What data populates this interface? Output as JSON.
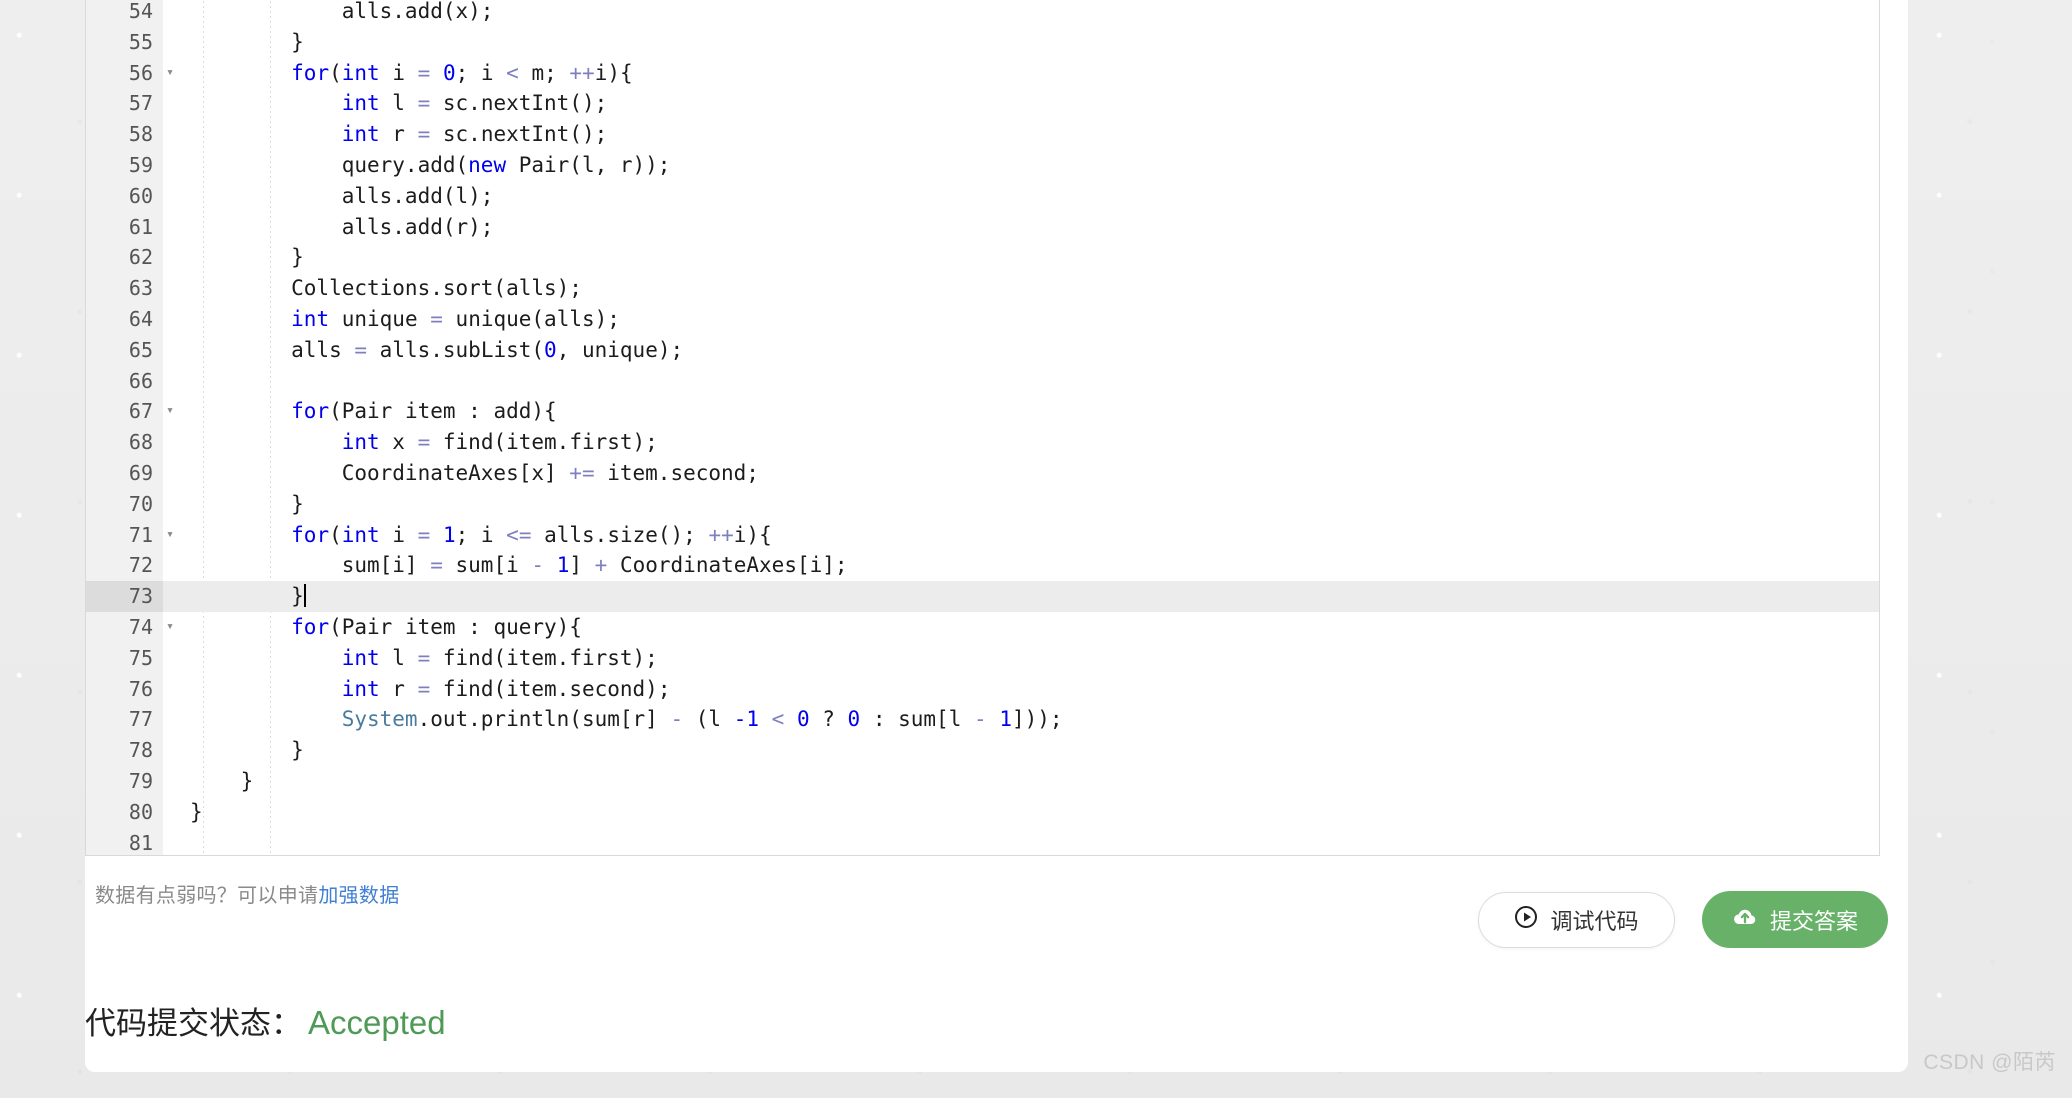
{
  "editor": {
    "language": "java",
    "active_line": 73,
    "first_visible_line": 54,
    "lines": [
      {
        "n": "54",
        "fold": false,
        "indent": 2,
        "tokens": [
          {
            "t": "            alls.add(x);",
            "c": "plain"
          }
        ]
      },
      {
        "n": "55",
        "fold": false,
        "indent": 2,
        "tokens": [
          {
            "t": "        }",
            "c": "plain"
          }
        ]
      },
      {
        "n": "56",
        "fold": true,
        "indent": 2,
        "tokens": [
          {
            "t": "        ",
            "c": "plain"
          },
          {
            "t": "for",
            "c": "kw"
          },
          {
            "t": "(",
            "c": "plain"
          },
          {
            "t": "int",
            "c": "kw"
          },
          {
            "t": " i ",
            "c": "plain"
          },
          {
            "t": "=",
            "c": "op"
          },
          {
            "t": " ",
            "c": "plain"
          },
          {
            "t": "0",
            "c": "num"
          },
          {
            "t": "; i ",
            "c": "plain"
          },
          {
            "t": "<",
            "c": "op"
          },
          {
            "t": " m; ",
            "c": "plain"
          },
          {
            "t": "++",
            "c": "op"
          },
          {
            "t": "i){",
            "c": "plain"
          }
        ]
      },
      {
        "n": "57",
        "fold": false,
        "indent": 3,
        "tokens": [
          {
            "t": "            ",
            "c": "plain"
          },
          {
            "t": "int",
            "c": "kw"
          },
          {
            "t": " l ",
            "c": "plain"
          },
          {
            "t": "=",
            "c": "op"
          },
          {
            "t": " sc.nextInt();",
            "c": "plain"
          }
        ]
      },
      {
        "n": "58",
        "fold": false,
        "indent": 3,
        "tokens": [
          {
            "t": "            ",
            "c": "plain"
          },
          {
            "t": "int",
            "c": "kw"
          },
          {
            "t": " r ",
            "c": "plain"
          },
          {
            "t": "=",
            "c": "op"
          },
          {
            "t": " sc.nextInt();",
            "c": "plain"
          }
        ]
      },
      {
        "n": "59",
        "fold": false,
        "indent": 3,
        "tokens": [
          {
            "t": "            query.add(",
            "c": "plain"
          },
          {
            "t": "new",
            "c": "kw"
          },
          {
            "t": " Pair(l, r));",
            "c": "plain"
          }
        ]
      },
      {
        "n": "60",
        "fold": false,
        "indent": 3,
        "tokens": [
          {
            "t": "            alls.add(l);",
            "c": "plain"
          }
        ]
      },
      {
        "n": "61",
        "fold": false,
        "indent": 3,
        "tokens": [
          {
            "t": "            alls.add(r);",
            "c": "plain"
          }
        ]
      },
      {
        "n": "62",
        "fold": false,
        "indent": 2,
        "tokens": [
          {
            "t": "        }",
            "c": "plain"
          }
        ]
      },
      {
        "n": "63",
        "fold": false,
        "indent": 2,
        "tokens": [
          {
            "t": "        Collections.sort(alls);",
            "c": "plain"
          }
        ]
      },
      {
        "n": "64",
        "fold": false,
        "indent": 2,
        "tokens": [
          {
            "t": "        ",
            "c": "plain"
          },
          {
            "t": "int",
            "c": "kw"
          },
          {
            "t": " unique ",
            "c": "plain"
          },
          {
            "t": "=",
            "c": "op"
          },
          {
            "t": " unique(alls);",
            "c": "plain"
          }
        ]
      },
      {
        "n": "65",
        "fold": false,
        "indent": 2,
        "tokens": [
          {
            "t": "        alls ",
            "c": "plain"
          },
          {
            "t": "=",
            "c": "op"
          },
          {
            "t": " alls.subList(",
            "c": "plain"
          },
          {
            "t": "0",
            "c": "num"
          },
          {
            "t": ", unique);",
            "c": "plain"
          }
        ]
      },
      {
        "n": "66",
        "fold": false,
        "indent": 0,
        "tokens": [
          {
            "t": "",
            "c": "plain"
          }
        ]
      },
      {
        "n": "67",
        "fold": true,
        "indent": 2,
        "tokens": [
          {
            "t": "        ",
            "c": "plain"
          },
          {
            "t": "for",
            "c": "kw"
          },
          {
            "t": "(Pair item : add){",
            "c": "plain"
          }
        ]
      },
      {
        "n": "68",
        "fold": false,
        "indent": 3,
        "tokens": [
          {
            "t": "            ",
            "c": "plain"
          },
          {
            "t": "int",
            "c": "kw"
          },
          {
            "t": " x ",
            "c": "plain"
          },
          {
            "t": "=",
            "c": "op"
          },
          {
            "t": " find(item.first);",
            "c": "plain"
          }
        ]
      },
      {
        "n": "69",
        "fold": false,
        "indent": 3,
        "tokens": [
          {
            "t": "            CoordinateAxes[x] ",
            "c": "plain"
          },
          {
            "t": "+=",
            "c": "op"
          },
          {
            "t": " item.second;",
            "c": "plain"
          }
        ]
      },
      {
        "n": "70",
        "fold": false,
        "indent": 2,
        "tokens": [
          {
            "t": "        }",
            "c": "plain"
          }
        ]
      },
      {
        "n": "71",
        "fold": true,
        "indent": 2,
        "tokens": [
          {
            "t": "        ",
            "c": "plain"
          },
          {
            "t": "for",
            "c": "kw"
          },
          {
            "t": "(",
            "c": "plain"
          },
          {
            "t": "int",
            "c": "kw"
          },
          {
            "t": " i ",
            "c": "plain"
          },
          {
            "t": "=",
            "c": "op"
          },
          {
            "t": " ",
            "c": "plain"
          },
          {
            "t": "1",
            "c": "num"
          },
          {
            "t": "; i ",
            "c": "plain"
          },
          {
            "t": "<=",
            "c": "op"
          },
          {
            "t": " alls.size(); ",
            "c": "plain"
          },
          {
            "t": "++",
            "c": "op"
          },
          {
            "t": "i){",
            "c": "plain"
          }
        ]
      },
      {
        "n": "72",
        "fold": false,
        "indent": 3,
        "tokens": [
          {
            "t": "            sum[i] ",
            "c": "plain"
          },
          {
            "t": "=",
            "c": "op"
          },
          {
            "t": " sum[i ",
            "c": "plain"
          },
          {
            "t": "-",
            "c": "op"
          },
          {
            "t": " ",
            "c": "plain"
          },
          {
            "t": "1",
            "c": "num"
          },
          {
            "t": "] ",
            "c": "plain"
          },
          {
            "t": "+",
            "c": "op"
          },
          {
            "t": " CoordinateAxes[i];",
            "c": "plain"
          }
        ]
      },
      {
        "n": "73",
        "fold": false,
        "indent": 2,
        "tokens": [
          {
            "t": "        }",
            "c": "plain"
          }
        ],
        "cursor": true
      },
      {
        "n": "74",
        "fold": true,
        "indent": 2,
        "tokens": [
          {
            "t": "        ",
            "c": "plain"
          },
          {
            "t": "for",
            "c": "kw"
          },
          {
            "t": "(Pair item : query){",
            "c": "plain"
          }
        ]
      },
      {
        "n": "75",
        "fold": false,
        "indent": 3,
        "tokens": [
          {
            "t": "            ",
            "c": "plain"
          },
          {
            "t": "int",
            "c": "kw"
          },
          {
            "t": " l ",
            "c": "plain"
          },
          {
            "t": "=",
            "c": "op"
          },
          {
            "t": " find(item.first);",
            "c": "plain"
          }
        ]
      },
      {
        "n": "76",
        "fold": false,
        "indent": 3,
        "tokens": [
          {
            "t": "            ",
            "c": "plain"
          },
          {
            "t": "int",
            "c": "kw"
          },
          {
            "t": " r ",
            "c": "plain"
          },
          {
            "t": "=",
            "c": "op"
          },
          {
            "t": " find(item.second);",
            "c": "plain"
          }
        ]
      },
      {
        "n": "77",
        "fold": false,
        "indent": 3,
        "tokens": [
          {
            "t": "            ",
            "c": "plain"
          },
          {
            "t": "System",
            "c": "cls"
          },
          {
            "t": ".out.println(sum[r] ",
            "c": "plain"
          },
          {
            "t": "-",
            "c": "op"
          },
          {
            "t": " (l ",
            "c": "plain"
          },
          {
            "t": "-1",
            "c": "num"
          },
          {
            "t": " ",
            "c": "plain"
          },
          {
            "t": "<",
            "c": "op"
          },
          {
            "t": " ",
            "c": "plain"
          },
          {
            "t": "0",
            "c": "num"
          },
          {
            "t": " ? ",
            "c": "plain"
          },
          {
            "t": "0",
            "c": "num"
          },
          {
            "t": " : sum[l ",
            "c": "plain"
          },
          {
            "t": "-",
            "c": "op"
          },
          {
            "t": " ",
            "c": "plain"
          },
          {
            "t": "1",
            "c": "num"
          },
          {
            "t": "]));",
            "c": "plain"
          }
        ]
      },
      {
        "n": "78",
        "fold": false,
        "indent": 2,
        "tokens": [
          {
            "t": "        }",
            "c": "plain"
          }
        ]
      },
      {
        "n": "79",
        "fold": false,
        "indent": 1,
        "tokens": [
          {
            "t": "    }",
            "c": "plain"
          }
        ]
      },
      {
        "n": "80",
        "fold": false,
        "indent": 0,
        "tokens": [
          {
            "t": "}",
            "c": "plain"
          }
        ]
      },
      {
        "n": "81",
        "fold": false,
        "indent": 0,
        "tokens": [
          {
            "t": "",
            "c": "plain"
          }
        ]
      }
    ]
  },
  "hint": {
    "text_before": "数据有点弱吗？可以申请",
    "link_label": "加强数据"
  },
  "toolbar": {
    "debug_label": "调试代码",
    "debug_icon": "play-circle-icon",
    "submit_label": "提交答案",
    "submit_icon": "cloud-upload-icon",
    "submit_color": "#67b168"
  },
  "status": {
    "label": "代码提交状态：",
    "value": "Accepted",
    "value_color": "#4e9a56"
  },
  "watermark": {
    "text": "CSDN @陌芮"
  }
}
